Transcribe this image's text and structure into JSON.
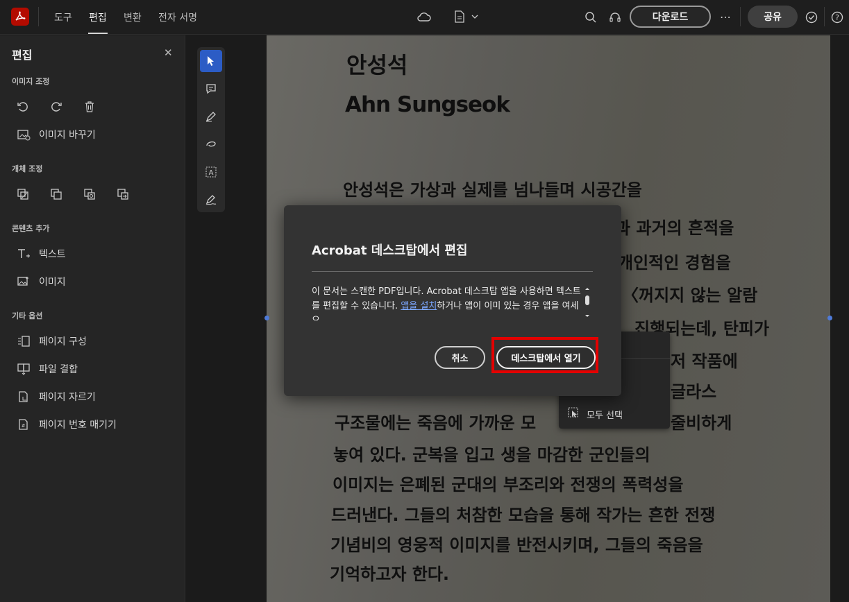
{
  "header": {
    "tabs": [
      {
        "label": "도구"
      },
      {
        "label": "편집"
      },
      {
        "label": "변환"
      },
      {
        "label": "전자 서명"
      }
    ],
    "download_label": "다운로드",
    "share_label": "공유"
  },
  "panel": {
    "title": "편집",
    "sections": {
      "image_adjust": "이미지 조정",
      "object_adjust": "개체 조정",
      "add_content": "콘텐츠 추가",
      "other_options": "기타 옵션"
    },
    "replace_image": "이미지 바꾸기",
    "add_text": "텍스트",
    "add_image": "이미지",
    "organize_pages": "페이지 구성",
    "combine_files": "파일 결합",
    "crop_pages": "페이지 자르기",
    "page_numbers": "페이지 번호 매기기"
  },
  "document": {
    "name_ko": "안성석",
    "name_en": "Ahn Sungseok",
    "lines": [
      "안성석은 가상과 실제를 넘나들며 시공간을",
      "과 과거의 흔적을",
      "개인적인 경험을",
      "〈꺼지지 않는 알람",
      "진행되는데, 탄피가",
      "저 작품에",
      "글라스",
      "구조물에는 죽음에 가까운 모",
      "줄비하게",
      "놓여 있다. 군복을 입고 생을 마감한 군인들의",
      "이미지는 은폐된 군대의 부조리와 전쟁의 폭력성을",
      "드러낸다. 그들의 처참한 모습을 통해 작가는 흔한 전쟁",
      "기념비의 영웅적 이미지를 반전시키며, 그들의 죽음을",
      "기억하고자 한다."
    ]
  },
  "context_menu": {
    "select_all": "모두 선택"
  },
  "dialog": {
    "title": "Acrobat 데스크탑에서 편집",
    "body_before_link": "이 문서는 스캔한 PDF입니다. Acrobat 데스크탑 앱을 사용하면 텍스트를 편집할 수 있습니다. ",
    "link": "앱을 설치",
    "body_after_link": "하거나 앱이 이미 있는 경우 앱을 여세요.",
    "cancel": "취소",
    "open": "데스크탑에서 열기"
  }
}
